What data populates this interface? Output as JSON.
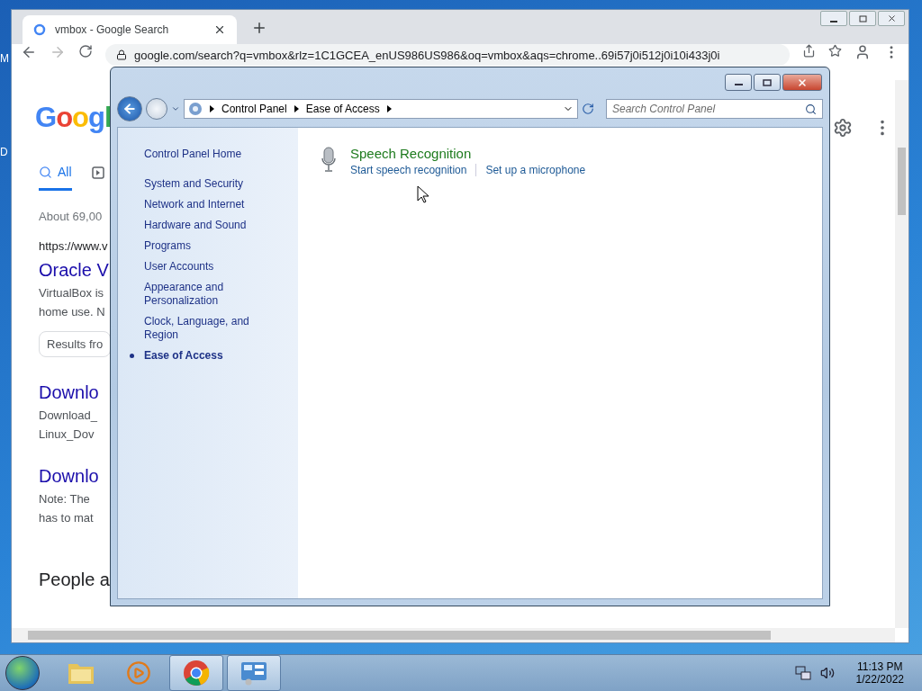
{
  "desktop": {
    "labels": [
      "M",
      "D"
    ]
  },
  "browser": {
    "tab_title": "vmbox - Google Search",
    "url": "google.com/search?q=vmbox&rlz=1C1GCEA_enUS986US986&oq=vmbox&aqs=chrome..69i57j0i512j0i10i433j0i",
    "logo": "Googl",
    "search_tab": "All",
    "stats": "About 69,00",
    "results": [
      {
        "kind": "cite",
        "text": "https://www.v"
      },
      {
        "kind": "title",
        "text": "Oracle V"
      },
      {
        "kind": "snippet",
        "text": "VirtualBox is"
      },
      {
        "kind": "snippet",
        "text": "home use. N"
      },
      {
        "kind": "chip",
        "text": "Results fro"
      },
      {
        "kind": "subtitle",
        "text": "Downlo"
      },
      {
        "kind": "snippet",
        "text": "Download_"
      },
      {
        "kind": "snippet",
        "text": "Linux_Dov"
      },
      {
        "kind": "subtitle",
        "text": "Downlo"
      },
      {
        "kind": "snippet",
        "text": "Note: The"
      },
      {
        "kind": "snippet",
        "text": "has to mat"
      },
      {
        "kind": "heading",
        "text": "People a"
      }
    ]
  },
  "control_panel": {
    "breadcrumb": [
      "Control Panel",
      "Ease of Access"
    ],
    "search": {
      "placeholder": "Search Control Panel"
    },
    "home": "Control Panel Home",
    "nav": [
      {
        "label": "System and Security",
        "selected": false
      },
      {
        "label": "Network and Internet",
        "selected": false
      },
      {
        "label": "Hardware and Sound",
        "selected": false
      },
      {
        "label": "Programs",
        "selected": false
      },
      {
        "label": "User Accounts",
        "selected": false
      },
      {
        "label": "Appearance and Personalization",
        "selected": false
      },
      {
        "label": "Clock, Language, and Region",
        "selected": false
      },
      {
        "label": "Ease of Access",
        "selected": true
      }
    ],
    "section": {
      "title": "Speech Recognition",
      "links": [
        "Start speech recognition",
        "Set up a microphone"
      ]
    }
  },
  "taskbar": {
    "items": [
      {
        "kind": "folder",
        "selected": false
      },
      {
        "kind": "media",
        "selected": false
      },
      {
        "kind": "chrome",
        "selected": true
      },
      {
        "kind": "control-panel",
        "selected": true
      }
    ],
    "time": "11:13 PM",
    "date": "1/22/2022"
  }
}
